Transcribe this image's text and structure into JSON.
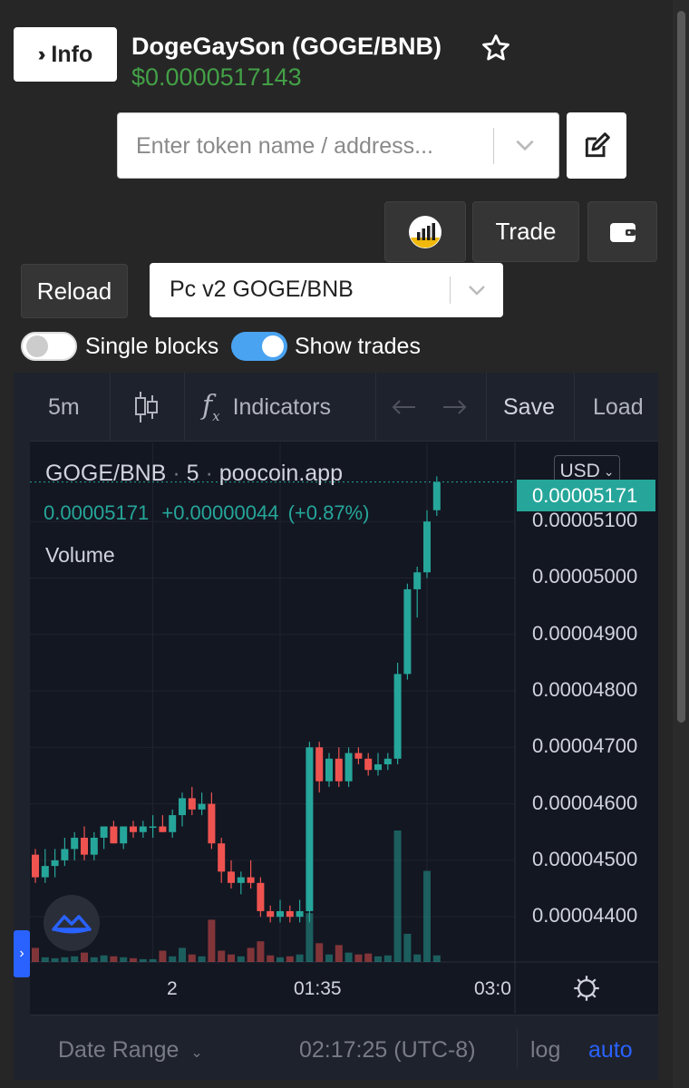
{
  "header": {
    "info_label": "Info",
    "token_title": "DogeGaySon (GOGE/BNB)",
    "token_price": "$0.0000517143",
    "price_color": "#43a047"
  },
  "search": {
    "placeholder": "Enter token name / address..."
  },
  "toolbar": {
    "trade_label": "Trade",
    "reload_label": "Reload",
    "pair_selected": "Pc v2 GOGE/BNB"
  },
  "toggles": {
    "single_blocks_label": "Single blocks",
    "single_blocks_on": false,
    "show_trades_label": "Show trades",
    "show_trades_on": true
  },
  "chart_toolbar": {
    "interval": "5m",
    "indicators_label": "Indicators",
    "save_label": "Save",
    "load_label": "Load"
  },
  "chart_legend": {
    "symbol": "GOGE/BNB",
    "interval": "5",
    "source": "poocoin.app",
    "last_value": "0.00005171",
    "change": "+0.00000044",
    "change_pct": "(+0.87%)",
    "volume_label": "Volume"
  },
  "chart_controls": {
    "currency": "USD",
    "price_tag": "0.00005171",
    "x_ticks": [
      "2",
      "01:35",
      "03:0"
    ],
    "date_range_label": "Date Range",
    "clock": "02:17:25 (UTC-8)",
    "log_label": "log",
    "auto_label": "auto"
  },
  "chart_data": {
    "type": "candlestick",
    "y_ticks": [
      "0.00005100",
      "0.00005000",
      "0.00004900",
      "0.00004800",
      "0.00004700",
      "0.00004600",
      "0.00004500",
      "0.00004400"
    ],
    "y_tick_values": [
      5.1e-05,
      5e-05,
      4.9e-05,
      4.8e-05,
      4.7e-05,
      4.6e-05,
      4.5e-05,
      4.4e-05
    ],
    "ylim": [
      4.32e-05,
      5.24e-05
    ],
    "up_color": "#26a69a",
    "down_color": "#ef5350",
    "candles": [
      {
        "o": 4.51e-05,
        "h": 4.52e-05,
        "l": 4.46e-05,
        "c": 4.47e-05,
        "v": 1.5
      },
      {
        "o": 4.47e-05,
        "h": 4.52e-05,
        "l": 4.46e-05,
        "c": 4.49e-05,
        "v": 0.5
      },
      {
        "o": 4.49e-05,
        "h": 4.52e-05,
        "l": 4.47e-05,
        "c": 4.5e-05,
        "v": 0.4
      },
      {
        "o": 4.5e-05,
        "h": 4.54e-05,
        "l": 4.49e-05,
        "c": 4.52e-05,
        "v": 0.5
      },
      {
        "o": 4.52e-05,
        "h": 4.55e-05,
        "l": 4.5e-05,
        "c": 4.54e-05,
        "v": 0.6
      },
      {
        "o": 4.54e-05,
        "h": 4.56e-05,
        "l": 4.5e-05,
        "c": 4.51e-05,
        "v": 1.0
      },
      {
        "o": 4.51e-05,
        "h": 4.55e-05,
        "l": 4.5e-05,
        "c": 4.54e-05,
        "v": 0.5
      },
      {
        "o": 4.54e-05,
        "h": 4.56e-05,
        "l": 4.52e-05,
        "c": 4.56e-05,
        "v": 0.7
      },
      {
        "o": 4.56e-05,
        "h": 4.57e-05,
        "l": 4.53e-05,
        "c": 4.53e-05,
        "v": 0.6
      },
      {
        "o": 4.53e-05,
        "h": 4.56e-05,
        "l": 4.52e-05,
        "c": 4.56e-05,
        "v": 0.5
      },
      {
        "o": 4.56e-05,
        "h": 4.57e-05,
        "l": 4.54e-05,
        "c": 4.55e-05,
        "v": 0.4
      },
      {
        "o": 4.55e-05,
        "h": 4.57e-05,
        "l": 4.54e-05,
        "c": 4.56e-05,
        "v": 0.3
      },
      {
        "o": 4.56e-05,
        "h": 4.58e-05,
        "l": 4.54e-05,
        "c": 4.56e-05,
        "v": 0.3
      },
      {
        "o": 4.56e-05,
        "h": 4.58e-05,
        "l": 4.55e-05,
        "c": 4.55e-05,
        "v": 1.2
      },
      {
        "o": 4.55e-05,
        "h": 4.59e-05,
        "l": 4.54e-05,
        "c": 4.58e-05,
        "v": 0.6
      },
      {
        "o": 4.58e-05,
        "h": 4.62e-05,
        "l": 4.56e-05,
        "c": 4.61e-05,
        "v": 1.5
      },
      {
        "o": 4.61e-05,
        "h": 4.63e-05,
        "l": 4.58e-05,
        "c": 4.59e-05,
        "v": 0.8
      },
      {
        "o": 4.59e-05,
        "h": 4.62e-05,
        "l": 4.58e-05,
        "c": 4.6e-05,
        "v": 0.6
      },
      {
        "o": 4.6e-05,
        "h": 4.62e-05,
        "l": 4.52e-05,
        "c": 4.53e-05,
        "v": 4.5
      },
      {
        "o": 4.53e-05,
        "h": 4.54e-05,
        "l": 4.46e-05,
        "c": 4.48e-05,
        "v": 1.2
      },
      {
        "o": 4.48e-05,
        "h": 4.5e-05,
        "l": 4.45e-05,
        "c": 4.46e-05,
        "v": 0.8
      },
      {
        "o": 4.46e-05,
        "h": 4.48e-05,
        "l": 4.44e-05,
        "c": 4.47e-05,
        "v": 0.6
      },
      {
        "o": 4.47e-05,
        "h": 4.5e-05,
        "l": 4.45e-05,
        "c": 4.46e-05,
        "v": 1.5
      },
      {
        "o": 4.46e-05,
        "h": 4.47e-05,
        "l": 4.4e-05,
        "c": 4.41e-05,
        "v": 2.2
      },
      {
        "o": 4.41e-05,
        "h": 4.42e-05,
        "l": 4.39e-05,
        "c": 4.4e-05,
        "v": 0.7
      },
      {
        "o": 4.4e-05,
        "h": 4.43e-05,
        "l": 4.39e-05,
        "c": 4.41e-05,
        "v": 0.5
      },
      {
        "o": 4.41e-05,
        "h": 4.42e-05,
        "l": 4.39e-05,
        "c": 4.4e-05,
        "v": 0.6
      },
      {
        "o": 4.4e-05,
        "h": 4.43e-05,
        "l": 4.39e-05,
        "c": 4.41e-05,
        "v": 0.8
      },
      {
        "o": 4.41e-05,
        "h": 4.71e-05,
        "l": 4.39e-05,
        "c": 4.7e-05,
        "v": 5.2
      },
      {
        "o": 4.7e-05,
        "h": 4.71e-05,
        "l": 4.62e-05,
        "c": 4.64e-05,
        "v": 2.0
      },
      {
        "o": 4.64e-05,
        "h": 4.69e-05,
        "l": 4.63e-05,
        "c": 4.68e-05,
        "v": 0.8
      },
      {
        "o": 4.68e-05,
        "h": 4.7e-05,
        "l": 4.63e-05,
        "c": 4.64e-05,
        "v": 1.8
      },
      {
        "o": 4.64e-05,
        "h": 4.7e-05,
        "l": 4.63e-05,
        "c": 4.69e-05,
        "v": 1.0
      },
      {
        "o": 4.69e-05,
        "h": 4.7e-05,
        "l": 4.67e-05,
        "c": 4.68e-05,
        "v": 0.8
      },
      {
        "o": 4.68e-05,
        "h": 4.69e-05,
        "l": 4.65e-05,
        "c": 4.66e-05,
        "v": 0.9
      },
      {
        "o": 4.66e-05,
        "h": 4.69e-05,
        "l": 4.65e-05,
        "c": 4.67e-05,
        "v": 0.6
      },
      {
        "o": 4.67e-05,
        "h": 4.69e-05,
        "l": 4.66e-05,
        "c": 4.68e-05,
        "v": 0.7
      },
      {
        "o": 4.68e-05,
        "h": 4.85e-05,
        "l": 4.67e-05,
        "c": 4.83e-05,
        "v": 14.0
      },
      {
        "o": 4.83e-05,
        "h": 4.99e-05,
        "l": 4.82e-05,
        "c": 4.98e-05,
        "v": 3.0
      },
      {
        "o": 4.98e-05,
        "h": 5.02e-05,
        "l": 4.93e-05,
        "c": 5.01e-05,
        "v": 0.8
      },
      {
        "o": 5.01e-05,
        "h": 5.12e-05,
        "l": 5e-05,
        "c": 5.1e-05,
        "v": 9.7
      },
      {
        "o": 5.12e-05,
        "h": 5.18e-05,
        "l": 5.11e-05,
        "c": 5.17e-05,
        "v": 0.7
      }
    ],
    "x_tick_indices": [
      12,
      25,
      40
    ]
  }
}
